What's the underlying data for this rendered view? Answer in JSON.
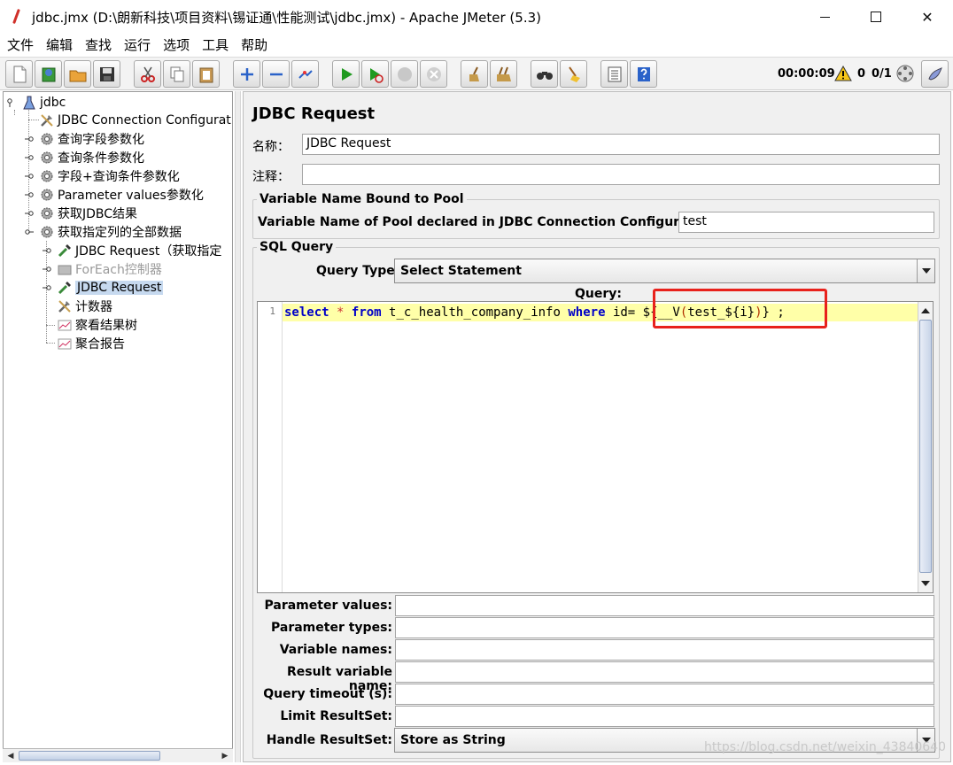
{
  "window": {
    "title": "jdbc.jmx (D:\\朗新科技\\项目资料\\锡证通\\性能测试\\jdbc.jmx) - Apache JMeter (5.3)",
    "min_label": "",
    "close_label": "✕"
  },
  "menu": [
    "文件",
    "编辑",
    "查找",
    "运行",
    "选项",
    "工具",
    "帮助"
  ],
  "toolbar": {
    "timer": "00:00:09",
    "warnings": "0",
    "threads": "0/1"
  },
  "tree": {
    "root": "jdbc",
    "items": [
      {
        "label": "JDBC Connection Configuratio"
      },
      {
        "label": "查询字段参数化"
      },
      {
        "label": "查询条件参数化"
      },
      {
        "label": "字段+查询条件参数化"
      },
      {
        "label": "Parameter values参数化"
      },
      {
        "label": "获取JDBC结果"
      },
      {
        "label": "获取指定列的全部数据"
      },
      {
        "label": "JDBC Request（获取指定"
      },
      {
        "label": "ForEach控制器"
      },
      {
        "label": "JDBC Request"
      },
      {
        "label": "计数器"
      },
      {
        "label": "察看结果树"
      },
      {
        "label": "聚合报告"
      }
    ]
  },
  "panel": {
    "title": "JDBC Request",
    "name_label": "名称：",
    "name_value": "JDBC Request",
    "comment_label": "注释：",
    "comment_value": "",
    "pool_group_title": "Variable Name Bound to Pool",
    "pool_label": "Variable Name of Pool declared in JDBC Connection Configuration:",
    "pool_value": "test",
    "sql_group_title": "SQL Query",
    "query_type_label": "Query Type:",
    "query_type_value": "Select Statement",
    "query_label": "Query:",
    "code": {
      "line_no": "1",
      "kw_select": "select",
      "star": "*",
      "kw_from": "from",
      "table": "t_c_health_company_info",
      "kw_where": "where",
      "cond": "id= ${__V",
      "paren_open": "(",
      "var": "test_${i}",
      "paren_close": ")",
      "tail": "} ;"
    },
    "params": [
      {
        "label": "Parameter values:",
        "value": ""
      },
      {
        "label": "Parameter types:",
        "value": ""
      },
      {
        "label": "Variable names:",
        "value": ""
      },
      {
        "label": "Result variable name:",
        "value": ""
      },
      {
        "label": "Query timeout (s):",
        "value": ""
      },
      {
        "label": "Limit ResultSet:",
        "value": ""
      }
    ],
    "handle_label": "Handle ResultSet:",
    "handle_value": "Store as String"
  },
  "watermark": "https://blog.csdn.net/weixin_43840640"
}
